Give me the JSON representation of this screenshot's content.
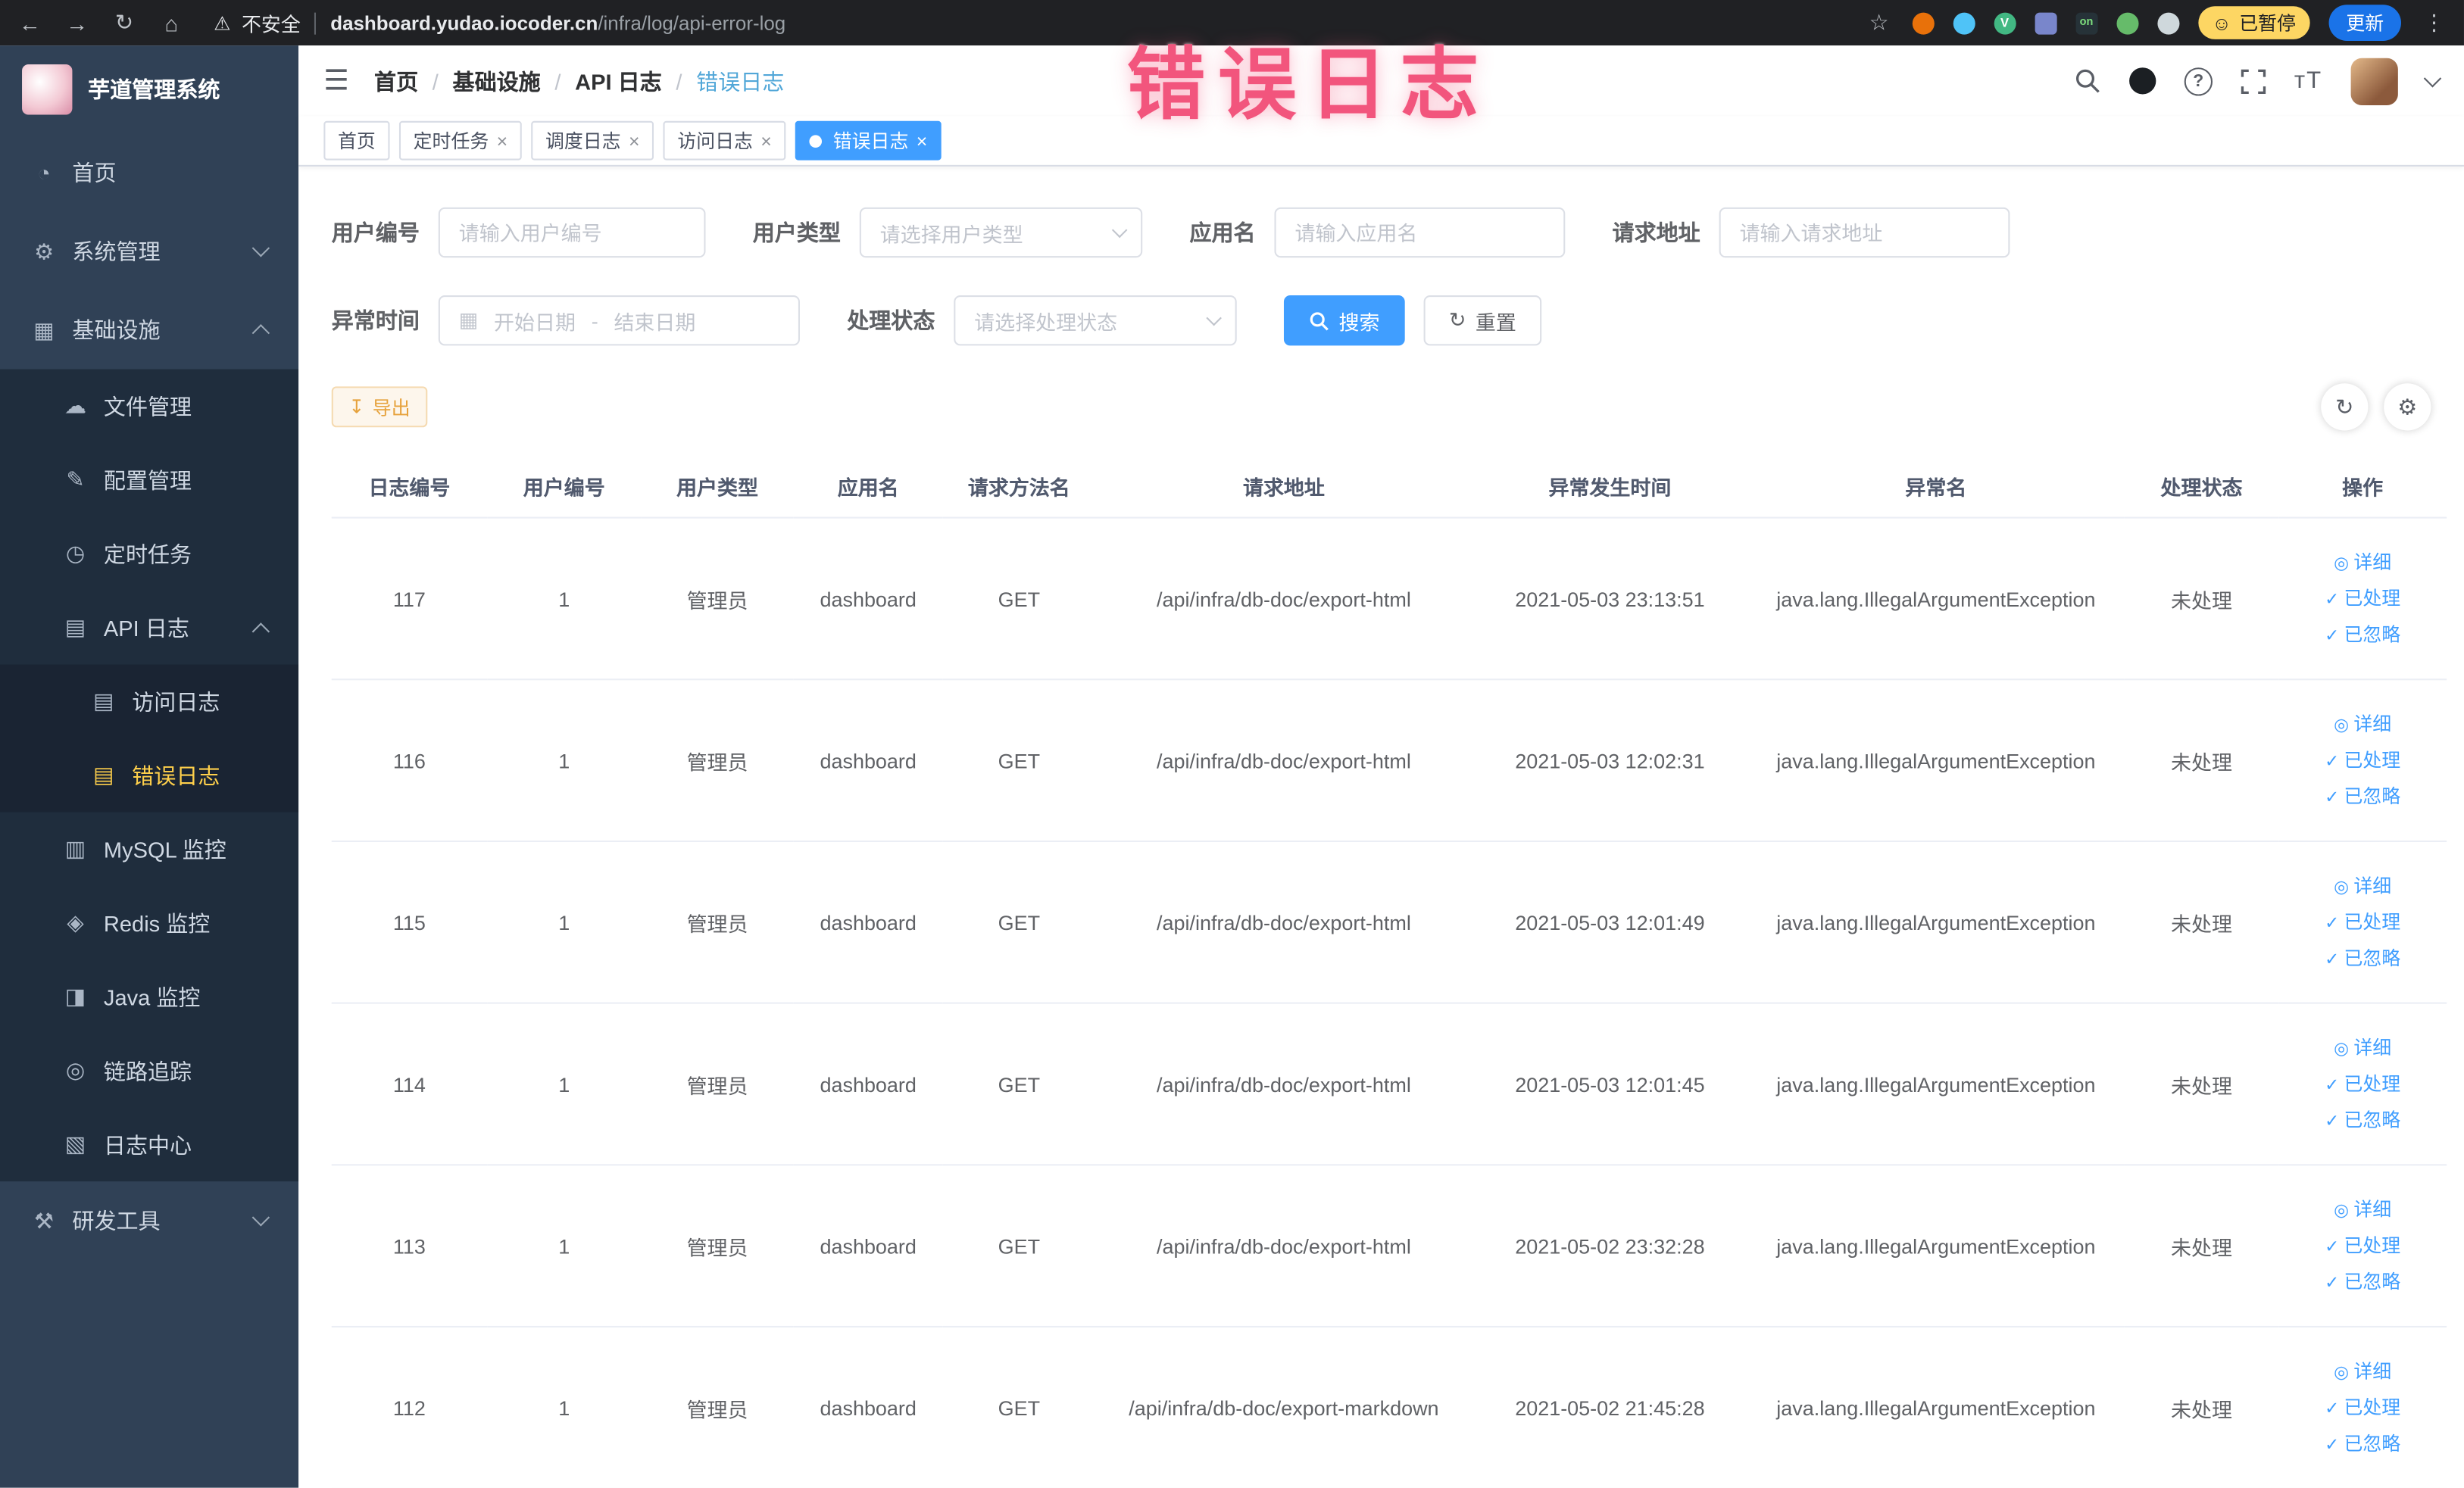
{
  "browser": {
    "security_label": "不安全",
    "url_domain": "dashboard.yudao.iocoder.cn",
    "url_path": "/infra/log/api-error-log",
    "ext_v": "V",
    "ext_on": "on",
    "paused_badge": "已暂停",
    "update_label": "更新"
  },
  "overlay_title": "错误日志",
  "icons": {
    "back": "←",
    "forward": "→",
    "reload": "↻",
    "home": "⌂",
    "warning": "⚠",
    "star": "☆",
    "more": "⋮",
    "smiley": "☺",
    "menu": "☰",
    "question": "?",
    "font_size": "тT",
    "dashboard": "◔",
    "gear": "⚙",
    "grid": "▦",
    "cloud": "☁",
    "edit": "✎",
    "clock": "◷",
    "doc": "▤",
    "mysql": "▥",
    "redis": "◈",
    "java": "◨",
    "trace": "◎",
    "logcenter": "▧",
    "tools": "⚒",
    "calendar": "▦",
    "download": "↧",
    "refresh": "↻",
    "settings": "⚙",
    "eye": "◎",
    "check": "✓",
    "close": "×",
    "crumb_sep": "/"
  },
  "sidebar": {
    "logo_title": "芋道管理系统",
    "items": {
      "home": "首页",
      "system": "系统管理",
      "infra": "基础设施",
      "file": "文件管理",
      "config": "配置管理",
      "job": "定时任务",
      "api_log": "API 日志",
      "access_log": "访问日志",
      "error_log": "错误日志",
      "mysql": "MySQL 监控",
      "redis": "Redis 监控",
      "java": "Java 监控",
      "trace": "链路追踪",
      "log_center": "日志中心",
      "dev_tools": "研发工具"
    }
  },
  "breadcrumb": [
    "首页",
    "基础设施",
    "API 日志",
    "错误日志"
  ],
  "tabs": [
    {
      "label": "首页",
      "closable": false,
      "active": false
    },
    {
      "label": "定时任务",
      "closable": true,
      "active": false
    },
    {
      "label": "调度日志",
      "closable": true,
      "active": false
    },
    {
      "label": "访问日志",
      "closable": true,
      "active": false
    },
    {
      "label": "错误日志",
      "closable": true,
      "active": true
    }
  ],
  "filters": {
    "user_id_label": "用户编号",
    "user_id_placeholder": "请输入用户编号",
    "user_type_label": "用户类型",
    "user_type_placeholder": "请选择用户类型",
    "app_name_label": "应用名",
    "app_name_placeholder": "请输入应用名",
    "request_url_label": "请求地址",
    "request_url_placeholder": "请输入请求地址",
    "exception_time_label": "异常时间",
    "date_start_placeholder": "开始日期",
    "date_separator": "-",
    "date_end_placeholder": "结束日期",
    "process_status_label": "处理状态",
    "process_status_placeholder": "请选择处理状态",
    "search_label": "搜索",
    "reset_label": "重置"
  },
  "toolbar": {
    "export_label": "导出"
  },
  "table": {
    "columns": [
      "日志编号",
      "用户编号",
      "用户类型",
      "应用名",
      "请求方法名",
      "请求地址",
      "异常发生时间",
      "异常名",
      "处理状态",
      "操作"
    ],
    "action_labels": {
      "detail": "详细",
      "processed": "已处理",
      "ignored": "已忽略"
    },
    "rows": [
      {
        "log_id": "117",
        "user_id": "1",
        "user_type": "管理员",
        "app_name": "dashboard",
        "method": "GET",
        "url": "/api/infra/db-doc/export-html",
        "time": "2021-05-03 23:13:51",
        "exception": "java.lang.IllegalArgumentException",
        "status": "未处理"
      },
      {
        "log_id": "116",
        "user_id": "1",
        "user_type": "管理员",
        "app_name": "dashboard",
        "method": "GET",
        "url": "/api/infra/db-doc/export-html",
        "time": "2021-05-03 12:02:31",
        "exception": "java.lang.IllegalArgumentException",
        "status": "未处理"
      },
      {
        "log_id": "115",
        "user_id": "1",
        "user_type": "管理员",
        "app_name": "dashboard",
        "method": "GET",
        "url": "/api/infra/db-doc/export-html",
        "time": "2021-05-03 12:01:49",
        "exception": "java.lang.IllegalArgumentException",
        "status": "未处理"
      },
      {
        "log_id": "114",
        "user_id": "1",
        "user_type": "管理员",
        "app_name": "dashboard",
        "method": "GET",
        "url": "/api/infra/db-doc/export-html",
        "time": "2021-05-03 12:01:45",
        "exception": "java.lang.IllegalArgumentException",
        "status": "未处理"
      },
      {
        "log_id": "113",
        "user_id": "1",
        "user_type": "管理员",
        "app_name": "dashboard",
        "method": "GET",
        "url": "/api/infra/db-doc/export-html",
        "time": "2021-05-02 23:32:28",
        "exception": "java.lang.IllegalArgumentException",
        "status": "未处理"
      },
      {
        "log_id": "112",
        "user_id": "1",
        "user_type": "管理员",
        "app_name": "dashboard",
        "method": "GET",
        "url": "/api/infra/db-doc/export-markdown",
        "time": "2021-05-02 21:45:28",
        "exception": "java.lang.IllegalArgumentException",
        "status": "未处理"
      }
    ]
  }
}
